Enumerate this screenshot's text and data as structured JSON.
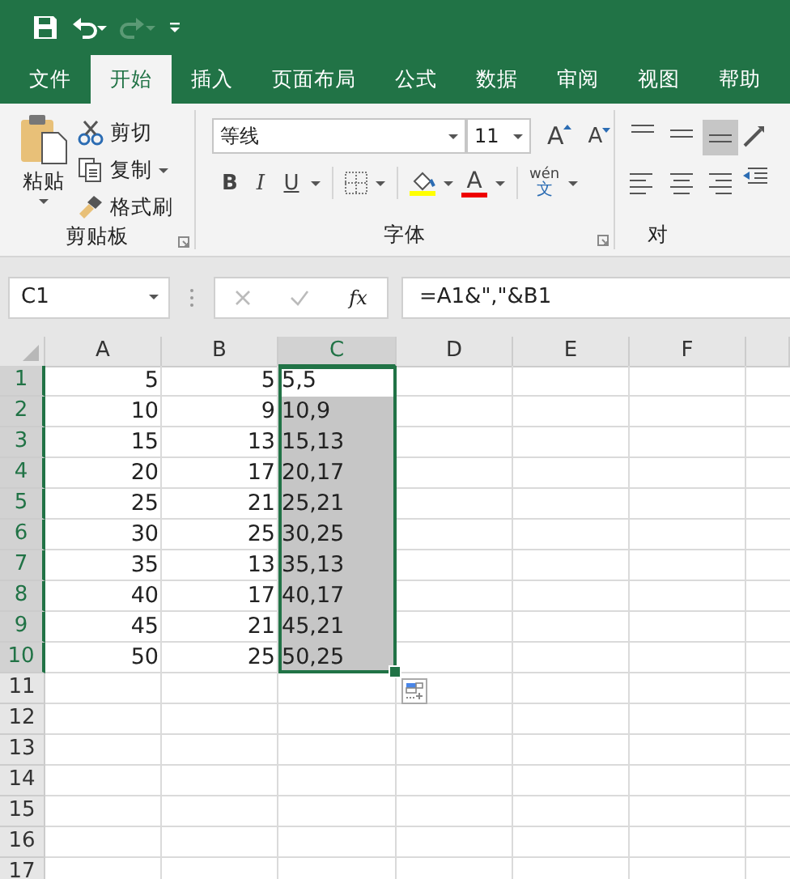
{
  "ribbon_tabs": [
    {
      "label": "文件",
      "selected": false
    },
    {
      "label": "开始",
      "selected": true
    },
    {
      "label": "插入",
      "selected": false
    },
    {
      "label": "页面布局",
      "selected": false
    },
    {
      "label": "公式",
      "selected": false
    },
    {
      "label": "数据",
      "selected": false
    },
    {
      "label": "审阅",
      "selected": false
    },
    {
      "label": "视图",
      "selected": false
    },
    {
      "label": "帮助",
      "selected": false
    }
  ],
  "clipboard": {
    "paste": "粘贴",
    "cut": "剪切",
    "copy": "复制",
    "format_painter": "格式刷",
    "group_label": "剪贴板"
  },
  "font": {
    "font_name": "等线",
    "font_size": "11",
    "grow_font": "A",
    "shrink_font": "A",
    "bold": "B",
    "italic": "I",
    "underline": "U",
    "font_color": "A",
    "phonetic_top": "wén",
    "phonetic_bottom": "文",
    "group_label": "字体"
  },
  "alignment": {
    "group_label": "对"
  },
  "name_box": "C1",
  "function_label": "fx",
  "formula": "=A1&\",\"&B1",
  "sheet": {
    "columns": [
      {
        "label": "A",
        "selected": false
      },
      {
        "label": "B",
        "selected": false
      },
      {
        "label": "C",
        "selected": true
      },
      {
        "label": "D",
        "selected": false
      },
      {
        "label": "E",
        "selected": false
      },
      {
        "label": "F",
        "selected": false
      }
    ],
    "rows": [
      {
        "label": "1",
        "selected": true,
        "cells": [
          {
            "text": "5",
            "selected": false,
            "active": false
          },
          {
            "text": "5",
            "selected": false,
            "active": false
          },
          {
            "text": "5,5",
            "selected": true,
            "active": true
          }
        ]
      },
      {
        "label": "2",
        "selected": true,
        "cells": [
          {
            "text": "10",
            "selected": false,
            "active": false
          },
          {
            "text": "9",
            "selected": false,
            "active": false
          },
          {
            "text": "10,9",
            "selected": true,
            "active": false
          }
        ]
      },
      {
        "label": "3",
        "selected": true,
        "cells": [
          {
            "text": "15",
            "selected": false,
            "active": false
          },
          {
            "text": "13",
            "selected": false,
            "active": false
          },
          {
            "text": "15,13",
            "selected": true,
            "active": false
          }
        ]
      },
      {
        "label": "4",
        "selected": true,
        "cells": [
          {
            "text": "20",
            "selected": false,
            "active": false
          },
          {
            "text": "17",
            "selected": false,
            "active": false
          },
          {
            "text": "20,17",
            "selected": true,
            "active": false
          }
        ]
      },
      {
        "label": "5",
        "selected": true,
        "cells": [
          {
            "text": "25",
            "selected": false,
            "active": false
          },
          {
            "text": "21",
            "selected": false,
            "active": false
          },
          {
            "text": "25,21",
            "selected": true,
            "active": false
          }
        ]
      },
      {
        "label": "6",
        "selected": true,
        "cells": [
          {
            "text": "30",
            "selected": false,
            "active": false
          },
          {
            "text": "25",
            "selected": false,
            "active": false
          },
          {
            "text": "30,25",
            "selected": true,
            "active": false
          }
        ]
      },
      {
        "label": "7",
        "selected": true,
        "cells": [
          {
            "text": "35",
            "selected": false,
            "active": false
          },
          {
            "text": "13",
            "selected": false,
            "active": false
          },
          {
            "text": "35,13",
            "selected": true,
            "active": false
          }
        ]
      },
      {
        "label": "8",
        "selected": true,
        "cells": [
          {
            "text": "40",
            "selected": false,
            "active": false
          },
          {
            "text": "17",
            "selected": false,
            "active": false
          },
          {
            "text": "40,17",
            "selected": true,
            "active": false
          }
        ]
      },
      {
        "label": "9",
        "selected": true,
        "cells": [
          {
            "text": "45",
            "selected": false,
            "active": false
          },
          {
            "text": "21",
            "selected": false,
            "active": false
          },
          {
            "text": "45,21",
            "selected": true,
            "active": false
          }
        ]
      },
      {
        "label": "10",
        "selected": true,
        "cells": [
          {
            "text": "50",
            "selected": false,
            "active": false
          },
          {
            "text": "25",
            "selected": false,
            "active": false
          },
          {
            "text": "50,25",
            "selected": true,
            "active": false
          }
        ]
      },
      {
        "label": "11",
        "selected": false
      },
      {
        "label": "12",
        "selected": false
      },
      {
        "label": "13",
        "selected": false
      },
      {
        "label": "14",
        "selected": false
      },
      {
        "label": "15",
        "selected": false
      },
      {
        "label": "16",
        "selected": false
      },
      {
        "label": "17",
        "selected": false
      }
    ]
  }
}
